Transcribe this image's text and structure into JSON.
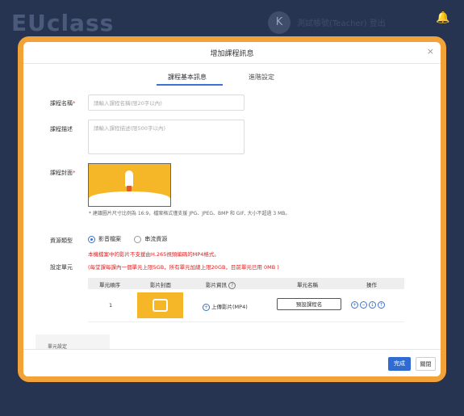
{
  "background": {
    "logo": "EUclass",
    "user_initial": "K",
    "user_text": "測試帳號(Teacher)   登出",
    "bell": "🔔"
  },
  "modal": {
    "title": "增加課程訊息",
    "close": "×",
    "tabs": [
      {
        "label": "課程基本訊息"
      },
      {
        "label": "進階設定"
      }
    ],
    "fields": {
      "name_label": "課程名稱",
      "name_placeholder": "請輸入課程名稱(限20字以內)",
      "desc_label": "課程描述",
      "desc_placeholder": "請輸入課程描述(限500字以內)",
      "cover_label": "課程封面",
      "cover_hint": "* 建議圖片尺寸比例為 16:9，檔案格式僅支援 JPG、JPEG、BMP 和 GIF, 大小不超過 3 MB。",
      "resource_label": "資源類型",
      "resource_options": [
        {
          "label": "影音檔案",
          "checked": true
        },
        {
          "label": "串流資源",
          "checked": false
        }
      ],
      "warning_1": "本機檔案中的影片不支援由H.265視頻編碼的MP4格式。",
      "unit_label": "設定單元",
      "warning_2": "(每堂課每課內一個單元上限5GB，所有單元加總上限20GB，目前單元已用 0MB )"
    },
    "table": {
      "headers": [
        "單元順序",
        "影片封面",
        "影片資訊",
        "單元名稱",
        "操作"
      ],
      "rows": [
        {
          "order": "1",
          "info": "上傳影片(MP4)",
          "name_button": "預設課程名"
        }
      ]
    },
    "behind_text": "單元設定",
    "footer": {
      "submit": "完成",
      "cancel": "關閉"
    }
  }
}
